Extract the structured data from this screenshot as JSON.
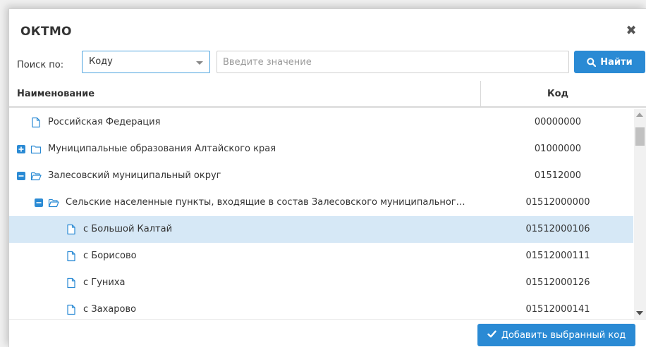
{
  "dialog": {
    "title": "ОКТМО"
  },
  "search": {
    "label": "Поиск по:",
    "field_selected": "Коду",
    "placeholder": "Введите значение",
    "value": "",
    "button_label": "Найти"
  },
  "table": {
    "columns": [
      "Наименование",
      "Код"
    ],
    "rows": [
      {
        "name": "Российская Федерация",
        "code": "00000000",
        "level": 0,
        "toggle": "none",
        "icon": "file-icon",
        "selected": false
      },
      {
        "name": "Муниципальные образования Алтайского края",
        "code": "01000000",
        "level": 0,
        "toggle": "expand",
        "icon": "folder-closed-icon",
        "selected": false
      },
      {
        "name": "Залесовский муниципальный округ",
        "code": "01512000",
        "level": 0,
        "toggle": "collapse",
        "icon": "folder-open-icon",
        "selected": false
      },
      {
        "name": "Сельские населенные пункты, входящие в состав Залесовского муниципальног…",
        "code": "01512000000",
        "level": 1,
        "toggle": "collapse",
        "icon": "folder-open-icon",
        "selected": false
      },
      {
        "name": "с Большой Калтай",
        "code": "01512000106",
        "level": 2,
        "toggle": "none",
        "icon": "file-icon",
        "selected": true
      },
      {
        "name": "с Борисово",
        "code": "01512000111",
        "level": 2,
        "toggle": "none",
        "icon": "file-icon",
        "selected": false
      },
      {
        "name": "с Гуниха",
        "code": "01512000126",
        "level": 2,
        "toggle": "none",
        "icon": "file-icon",
        "selected": false
      },
      {
        "name": "с Захарово",
        "code": "01512000141",
        "level": 2,
        "toggle": "none",
        "icon": "file-icon",
        "selected": false
      }
    ]
  },
  "footer": {
    "add_button_label": "Добавить выбранный код"
  },
  "colors": {
    "accent": "#2a8ad4",
    "selected_row": "#d6e8f6",
    "toggle_icon": "#2a8ad4",
    "tree_icon": "#2a8ad4"
  }
}
